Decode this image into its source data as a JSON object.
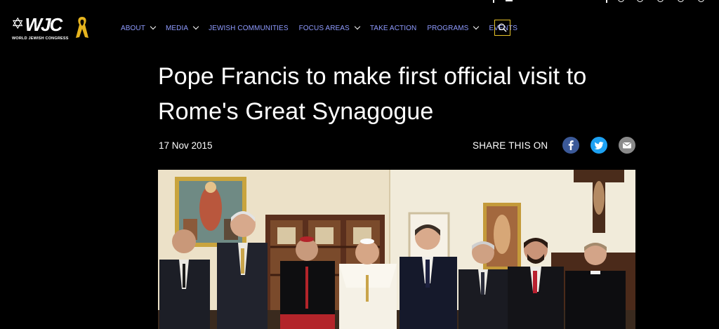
{
  "header": {
    "logo": {
      "letters": "WJC",
      "caption": "WORLD JEWISH CONGRESS"
    },
    "nav": [
      {
        "label": "ABOUT",
        "has_dropdown": true
      },
      {
        "label": "MEDIA",
        "has_dropdown": true
      },
      {
        "label": "JEWISH COMMUNITIES",
        "has_dropdown": false
      },
      {
        "label": "FOCUS AREAS",
        "has_dropdown": true
      },
      {
        "label": "TAKE ACTION",
        "has_dropdown": false
      },
      {
        "label": "PROGRAMS",
        "has_dropdown": true
      },
      {
        "label": "EVENTS",
        "has_dropdown": false
      }
    ],
    "search_icon": "search-icon",
    "colors": {
      "nav_link": "#8f9bff",
      "search_border": "#e6c229",
      "ribbon": "#e6b41e"
    }
  },
  "article": {
    "title": "Pope Francis to make first official visit to Rome's Great Synagogue",
    "date": "17 Nov 2015",
    "share_label": "SHARE THIS ON",
    "share_icons": [
      "facebook-icon",
      "twitter-icon",
      "email-icon"
    ],
    "share_colors": {
      "facebook": "#3b5998",
      "twitter": "#1da1f2",
      "email": "#8a8a8a"
    }
  }
}
